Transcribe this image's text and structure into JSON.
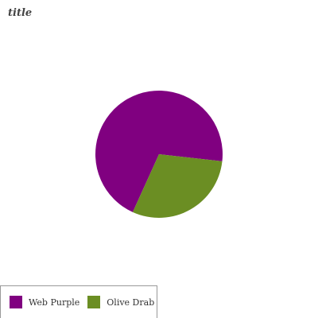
{
  "chart_data": {
    "type": "pie",
    "title": "title",
    "categories": [
      "Web Purple",
      "Olive Drab"
    ],
    "values": [
      70,
      30
    ],
    "colors": [
      "#800080",
      "#6b8e23"
    ],
    "legend": {
      "placement": "bottom-left",
      "entries": [
        "Web Purple",
        "Olive Drab"
      ]
    }
  }
}
